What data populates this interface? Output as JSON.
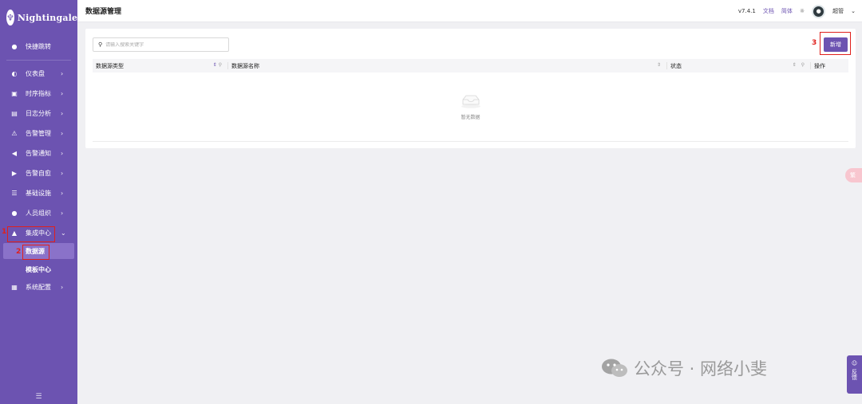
{
  "app": {
    "logo_text": "Nightingale"
  },
  "sidebar": {
    "quick_jump": "快捷跳转",
    "items": [
      {
        "label": "仪表盘",
        "icon": "dashboard-icon"
      },
      {
        "label": "时序指标",
        "icon": "line-chart-icon"
      },
      {
        "label": "日志分析",
        "icon": "log-icon"
      },
      {
        "label": "告警管理",
        "icon": "alarm-icon"
      },
      {
        "label": "告警通知",
        "icon": "megaphone-icon"
      },
      {
        "label": "告警自愈",
        "icon": "terminal-icon"
      },
      {
        "label": "基础设施",
        "icon": "server-icon"
      },
      {
        "label": "人员组织",
        "icon": "user-icon"
      },
      {
        "label": "集成中心",
        "icon": "integration-icon"
      },
      {
        "label": "系统配置",
        "icon": "grid-icon"
      }
    ],
    "sub_items": [
      {
        "label": "数据源"
      },
      {
        "label": "模板中心"
      }
    ],
    "annotations": [
      "1",
      "2"
    ]
  },
  "header": {
    "title": "数据源管理",
    "version": "v7.4.1",
    "docs": "文档",
    "lang": "简体",
    "user": "超管"
  },
  "toolbar": {
    "search_placeholder": "请输入搜索关键字",
    "add_label": "新增",
    "add_annotation": "3"
  },
  "table": {
    "columns": [
      "数据源类型",
      "数据源名称",
      "状态",
      "操作"
    ],
    "empty_text": "暂无数据"
  },
  "floaters": {
    "pink_label": "繁",
    "feedback_label": "反馈"
  },
  "watermark": {
    "text": "公众号 · 网络小斐"
  },
  "colors": {
    "primary": "#6c53b1",
    "annotation_red": "#e0201c",
    "background": "#f0f0f3"
  }
}
